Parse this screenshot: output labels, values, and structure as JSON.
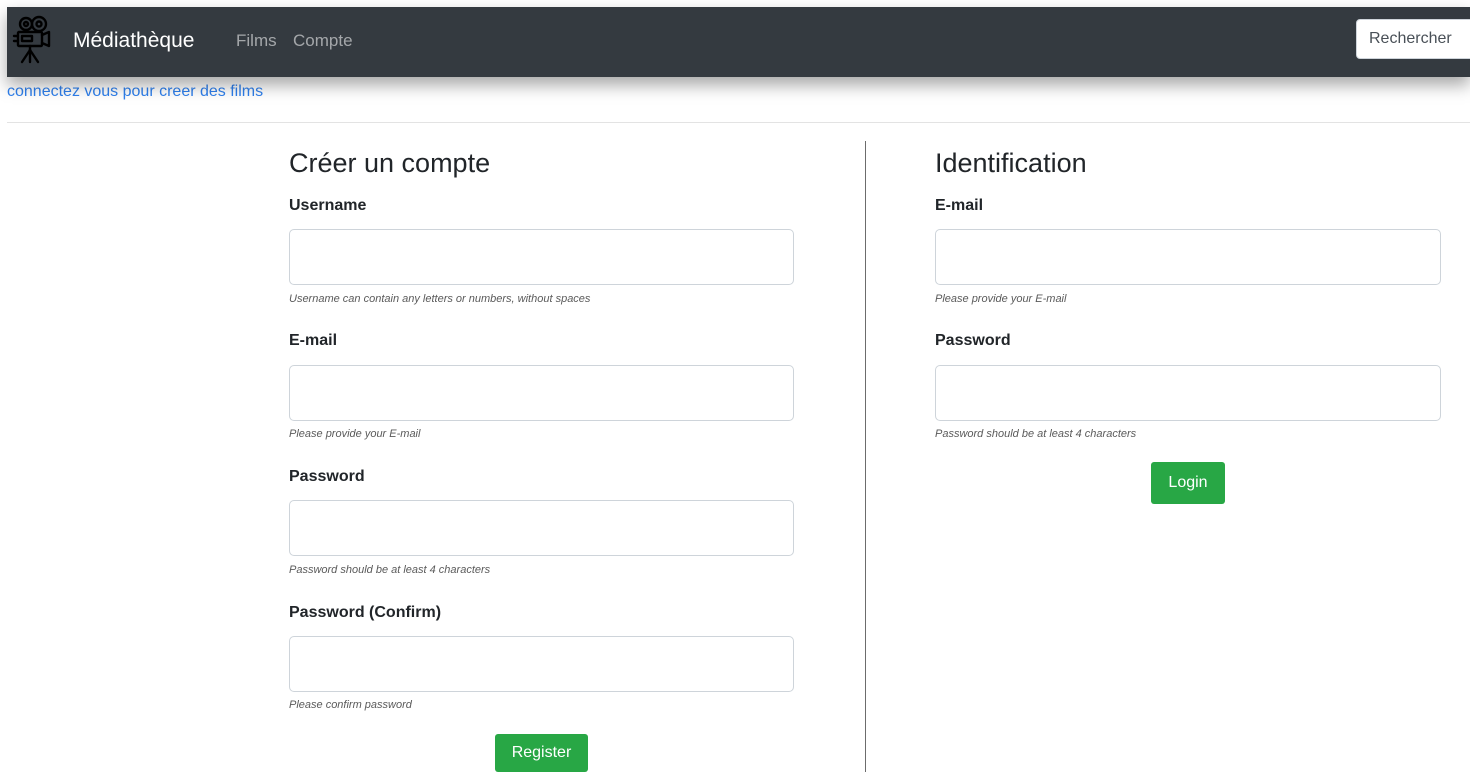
{
  "navbar": {
    "brand": "Médiathèque",
    "links": [
      "Films",
      "Compte"
    ],
    "search_placeholder": "Rechercher"
  },
  "notice": "connectez vous pour creer des films",
  "register": {
    "title": "Créer un compte",
    "username_label": "Username",
    "username_help": "Username can contain any letters or numbers, without spaces",
    "email_label": "E-mail",
    "email_help": "Please provide your E-mail",
    "password_label": "Password",
    "password_help": "Password should be at least 4 characters",
    "confirm_label": "Password (Confirm)",
    "confirm_help": "Please confirm password",
    "button": "Register"
  },
  "login": {
    "title": "Identification",
    "email_label": "E-mail",
    "email_help": "Please provide your E-mail",
    "password_label": "Password",
    "password_help": "Password should be at least 4 characters",
    "button": "Login"
  },
  "colors": {
    "navbar_bg": "#343a40",
    "accent_link": "#2f80ed",
    "button_green": "#28a745"
  },
  "icons": {
    "logo": "movie-camera-icon"
  }
}
